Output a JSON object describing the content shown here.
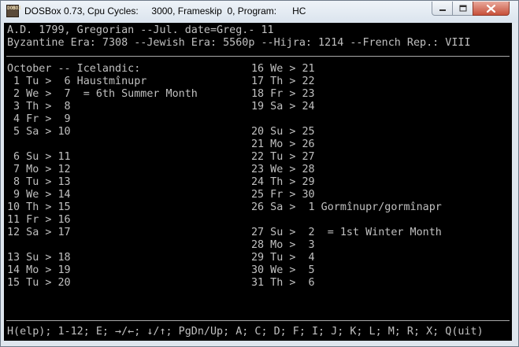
{
  "window": {
    "title": "DOSBox 0.73, Cpu Cycles:     3000, Frameskip  0, Program:      HC"
  },
  "app_icon": {
    "text": [
      "DOS",
      "BOX"
    ]
  },
  "header": {
    "line1": "A.D. 1799, Gregorian --Jul. date=Greg.- 11",
    "line2": "Byzantine Era: 7308 --Jewish Era: 5560p --Hijra: 1214 --French Rep.: VIII"
  },
  "calendar": {
    "left": [
      "October -- Icelandic:",
      " 1 Tu >  6 Haustmînupr",
      " 2 We >  7  = 6th Summer Month",
      " 3 Th >  8",
      " 4 Fr >  9",
      " 5 Sa > 10",
      "",
      " 6 Su > 11",
      " 7 Mo > 12",
      " 8 Tu > 13",
      " 9 We > 14",
      "10 Th > 15",
      "11 Fr > 16",
      "12 Sa > 17",
      "",
      "13 Su > 18",
      "14 Mo > 19",
      "15 Tu > 20"
    ],
    "right": [
      "16 We > 21",
      "17 Th > 22",
      "18 Fr > 23",
      "19 Sa > 24",
      "",
      "20 Su > 25",
      "21 Mo > 26",
      "22 Tu > 27",
      "23 We > 28",
      "24 Th > 29",
      "25 Fr > 30",
      "26 Sa >  1 Gormînupr/gormînapr",
      "",
      "27 Su >  2  = 1st Winter Month",
      "28 Mo >  3",
      "29 Tu >  4",
      "30 We >  5",
      "31 Th >  6"
    ]
  },
  "footer": {
    "help": "H(elp); 1-12; E; →/←; ↓/↑; PgDn/Up; A; C; D; F; I; J; K; L; M; R; X; Q(uit)"
  }
}
